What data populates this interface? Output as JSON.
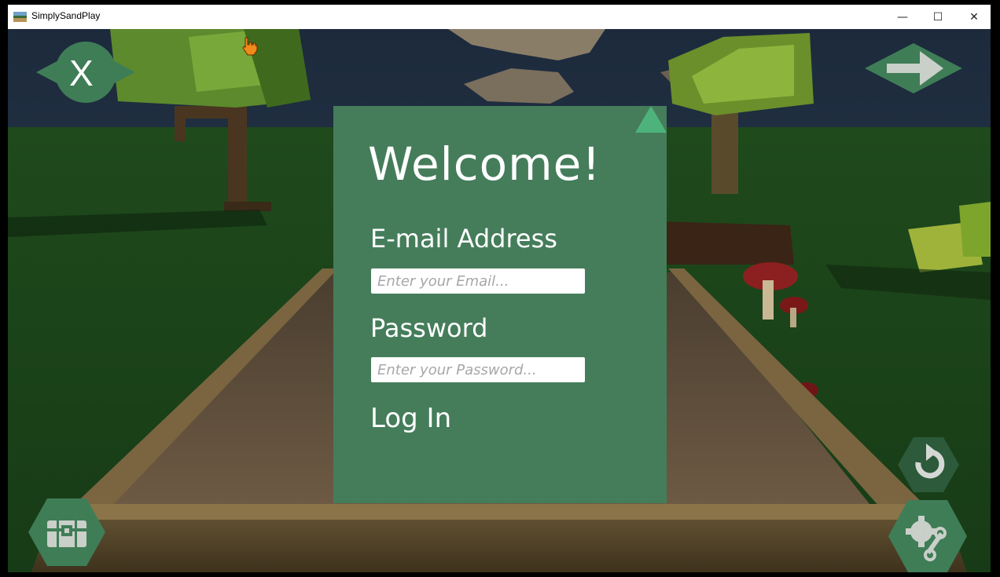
{
  "window": {
    "title": "SimplySandPlay",
    "minimize_glyph": "—",
    "maximize_glyph": "☐",
    "close_glyph": "✕"
  },
  "hud": {
    "close_label": "X",
    "close_icon": "x-icon",
    "next_icon": "arrow-right-icon",
    "undo_icon": "undo-icon",
    "toybox_icon": "toy-chest-icon",
    "settings_icon": "gear-wrench-icon",
    "accent": "#3f7d57"
  },
  "login": {
    "heading": "Welcome!",
    "email_label": "E-mail Address",
    "email_placeholder": "Enter your Email...",
    "email_value": "",
    "password_label": "Password",
    "password_placeholder": "Enter your Password...",
    "password_value": "",
    "submit_label": "Log In",
    "panel_color": "#457d5b"
  },
  "cursor": {
    "icon": "hand-pointer-icon"
  }
}
